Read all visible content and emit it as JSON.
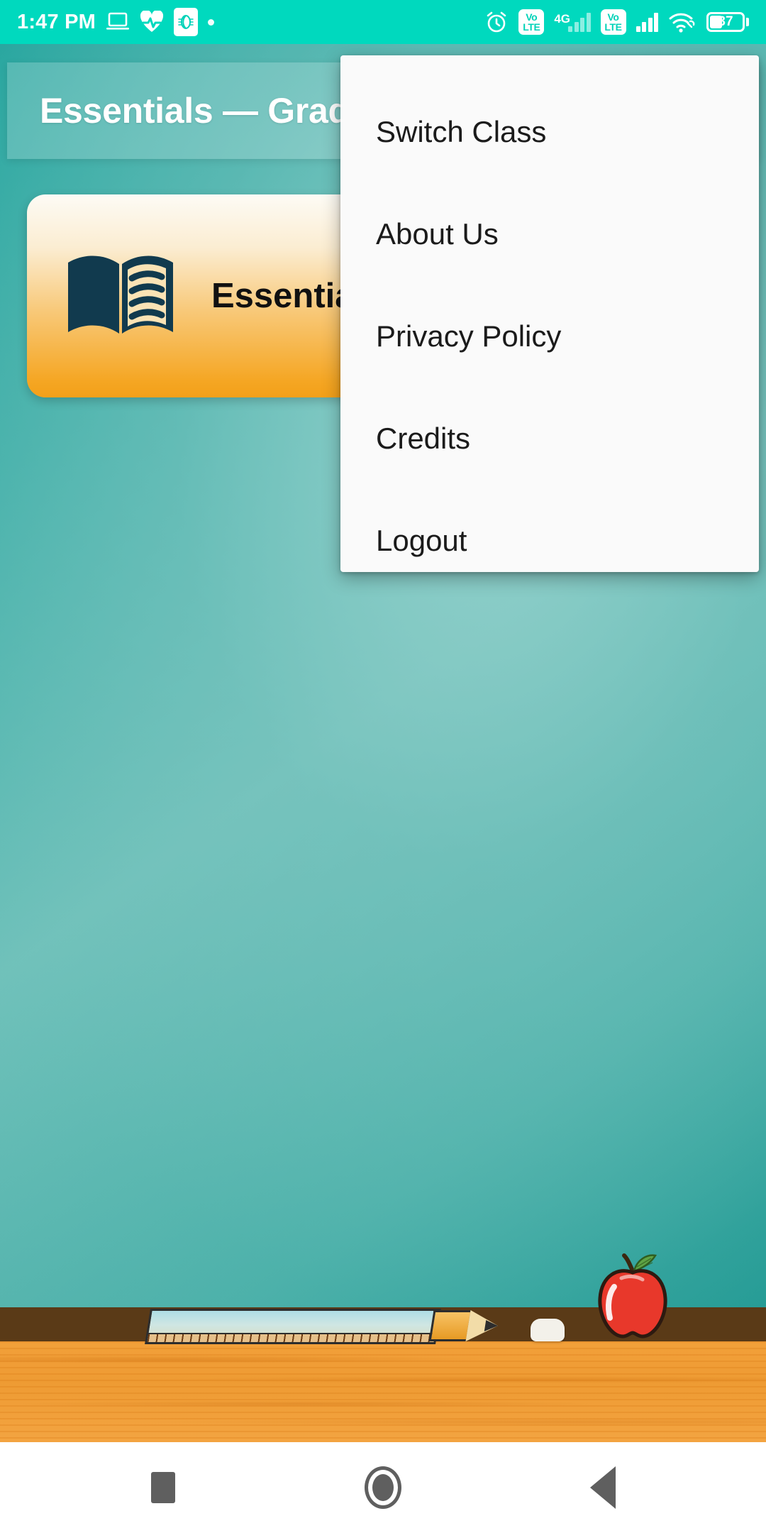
{
  "status_bar": {
    "time": "1:47 PM",
    "battery_percent": "37",
    "network_label": "4G",
    "volte_top": "Vo",
    "volte_bottom": "LTE",
    "icons": [
      "laptop-icon",
      "heart-pulse-icon",
      "app-notification-icon",
      "notification-dot-icon",
      "alarm-icon",
      "volte-icon",
      "signal-icon",
      "volte-icon",
      "signal-icon",
      "wifi-link-icon",
      "battery-icon"
    ],
    "background_color": "#00D9BE"
  },
  "app_bar": {
    "title": "Essentials — Grade"
  },
  "subject_card": {
    "label": "Essentials",
    "icon": "open-book-icon",
    "gradient_start": "#FDFBF5",
    "gradient_end": "#F3A019"
  },
  "overflow_menu": {
    "items": [
      {
        "label": "Switch Class"
      },
      {
        "label": "About Us"
      },
      {
        "label": "Privacy Policy"
      },
      {
        "label": "Credits"
      },
      {
        "label": "Logout"
      }
    ],
    "background_color": "#FAFAFA"
  },
  "background": {
    "board_color_light": "#74C3BC",
    "board_color_dark": "#18948E",
    "ledge_color": "#5A3A17",
    "desk_color": "#EE9B33",
    "apple_color": "#E8382B"
  },
  "nav_bar": {
    "buttons": [
      "recents-button",
      "home-button",
      "back-button"
    ],
    "icon_color": "#5F5F5F"
  }
}
